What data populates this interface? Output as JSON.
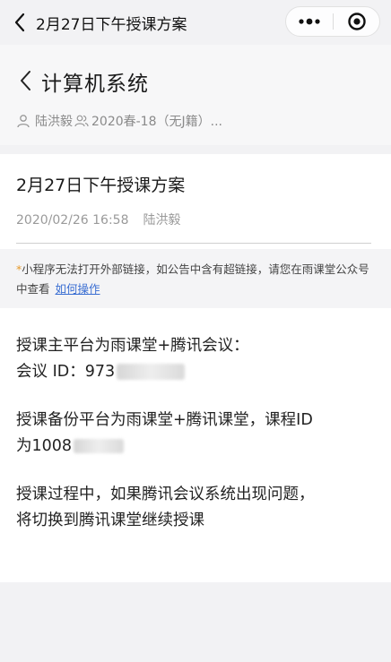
{
  "navbar": {
    "title": "2月27日下午授课方案"
  },
  "course": {
    "title": "计算机系统",
    "teacher": "陆洪毅",
    "classroom": "2020春-18（无J籍）..."
  },
  "announcement": {
    "title": "2月27日下午授课方案",
    "datetime": "2020/02/26 16:58",
    "author": "陆洪毅",
    "notice_star": "*",
    "notice_text": "小程序无法打开外部链接，如公告中含有超链接，请您在雨课堂公众号中查看",
    "notice_link": "如何操作",
    "paragraphs": {
      "p1_line1": "授课主平台为雨课堂+腾讯会议：",
      "p1_line2": "会议 ID：973",
      "p2_line1": "授课备份平台为雨课堂+腾讯课堂，课程ID",
      "p2_line2": "为1008",
      "p3_line1": "授课过程中，如果腾讯会议系统出现问题，",
      "p3_line2": "将切换到腾讯课堂继续授课"
    }
  },
  "icons": {
    "back": "chevron-left-icon",
    "more": "more-dots-icon",
    "close": "target-close-icon",
    "person": "person-icon",
    "group": "group-icon"
  }
}
